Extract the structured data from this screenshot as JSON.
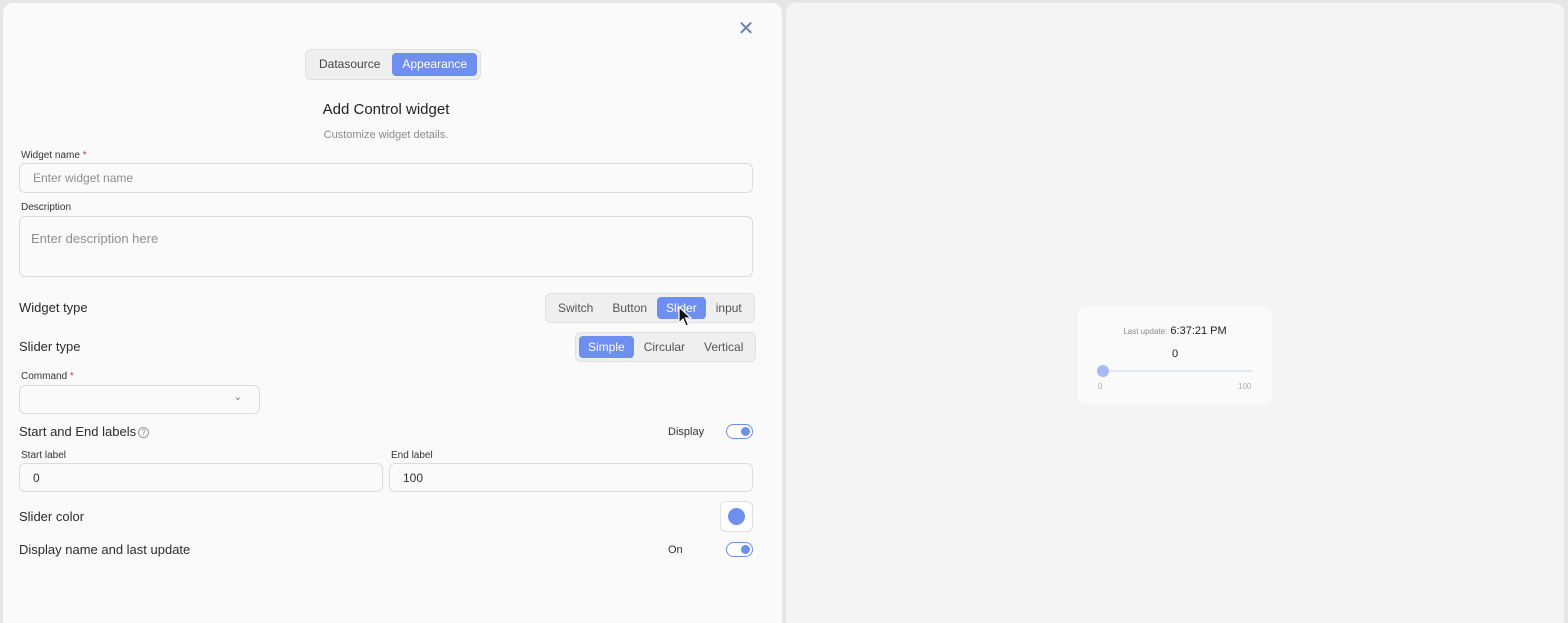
{
  "tabs": [
    {
      "label": "Datasource",
      "active": false
    },
    {
      "label": "Appearance",
      "active": true
    }
  ],
  "header": {
    "title": "Add Control widget",
    "subtitle": "Customize widget details."
  },
  "form": {
    "widget_name_label": "Widget name",
    "widget_name_placeholder": "Enter widget name",
    "widget_name_value": "",
    "required_mark": "*",
    "description_label": "Description",
    "description_placeholder": "Enter description here",
    "widget_type_label": "Widget type",
    "widget_type_options": [
      "Switch",
      "Button",
      "Slider",
      "input"
    ],
    "widget_type_selected": "Slider",
    "slider_type_label": "Slider type",
    "slider_type_options": [
      "Simple",
      "Circular",
      "Vertical"
    ],
    "slider_type_selected": "Simple",
    "command_label": "Command",
    "command_value": "",
    "start_end_label": "Start and End labels",
    "help_icon": "?",
    "display_label": "Display",
    "display_toggle_on": true,
    "start_label_label": "Start label",
    "start_label_value": "0",
    "end_label_label": "End label",
    "end_label_value": "100",
    "slider_color_label": "Slider color",
    "slider_color": "#6e8ef0",
    "display_name_label": "Display name and last update",
    "display_name_state": "On",
    "display_name_toggle_on": true
  },
  "preview": {
    "last_update_key": "Last update:",
    "last_update_time": "6:37:21 PM",
    "value": "0",
    "slider_level": 0,
    "min_label": "0",
    "max_label": "100"
  },
  "colors": {
    "accent": "#6e8ef0"
  }
}
